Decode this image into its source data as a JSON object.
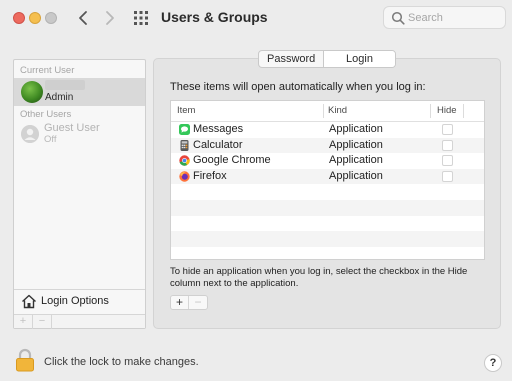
{
  "window": {
    "title": "Users & Groups",
    "search_placeholder": "Search"
  },
  "sidebar": {
    "current_user_label": "Current User",
    "current_user_role": "Admin",
    "other_users_label": "Other Users",
    "guest_user_name": "Guest User",
    "guest_user_status": "Off",
    "login_options_label": "Login Options",
    "add_symbol": "+",
    "remove_symbol": "−"
  },
  "tabs": [
    {
      "label": "Password",
      "selected": false
    },
    {
      "label": "Login Items",
      "selected": true
    }
  ],
  "main": {
    "intro": "These items will open automatically when you log in:",
    "columns": {
      "item": "Item",
      "kind": "Kind",
      "hide": "Hide"
    },
    "rows": [
      {
        "name": "Messages",
        "kind": "Application",
        "hide": false,
        "icon": "messages-icon",
        "color": "#34c759"
      },
      {
        "name": "Calculator",
        "kind": "Application",
        "hide": false,
        "icon": "calculator-icon",
        "color": "#5a5a5a"
      },
      {
        "name": "Google Chrome",
        "kind": "Application",
        "hide": false,
        "icon": "chrome-icon",
        "color": "#e8453c"
      },
      {
        "name": "Firefox",
        "kind": "Application",
        "hide": false,
        "icon": "firefox-icon",
        "color": "#ff7139"
      }
    ],
    "footnote": "To hide an application when you log in, select the checkbox in the Hide column next to the application.",
    "add_symbol": "+",
    "remove_symbol": "−"
  },
  "footer": {
    "lock_label": "Click the lock to make changes.",
    "help_symbol": "?"
  }
}
